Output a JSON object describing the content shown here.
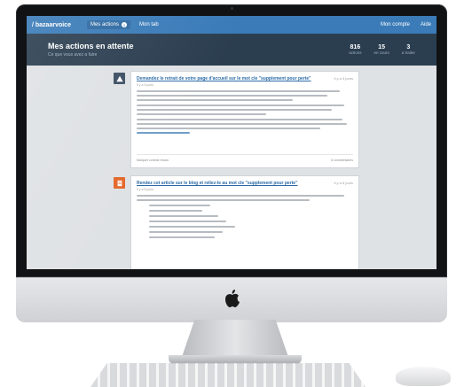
{
  "topbar": {
    "brand": "/ bazaarvoice",
    "nav": [
      {
        "label": "Mes actions",
        "badge": "3"
      },
      {
        "label": "Mon tab"
      }
    ],
    "right_links": [
      "Mon compte",
      "Aide"
    ]
  },
  "header": {
    "title": "Mes actions en attente",
    "subtitle": "Ce que vous avez a faire",
    "stats": [
      {
        "value": "816",
        "label": "actions"
      },
      {
        "value": "15",
        "label": "en cours"
      },
      {
        "value": "3",
        "label": "a traiter"
      }
    ]
  },
  "cards": [
    {
      "icon": "warning-icon",
      "title": "Demandez le retrait de votre page d'accueil sur le mot cle \"supplement pour perte\"",
      "time": "il y a 3 jours",
      "meta": "Il y a 3 jours",
      "footer_left": "Marquer comme resolu",
      "footer_right": "6 commentaires"
    },
    {
      "icon": "document-icon",
      "title": "Rendez cet article sur le blog et reliez-le au mot cle \"supplement pour perte\"",
      "time": "il y a 5 jours",
      "meta": "Il y a 5 jours"
    }
  ],
  "colors": {
    "topbar": "#3a7bb8",
    "header": "#2b3e50",
    "warning_icon_bg": "#3c4f63",
    "document_icon_bg": "#e4672a"
  }
}
